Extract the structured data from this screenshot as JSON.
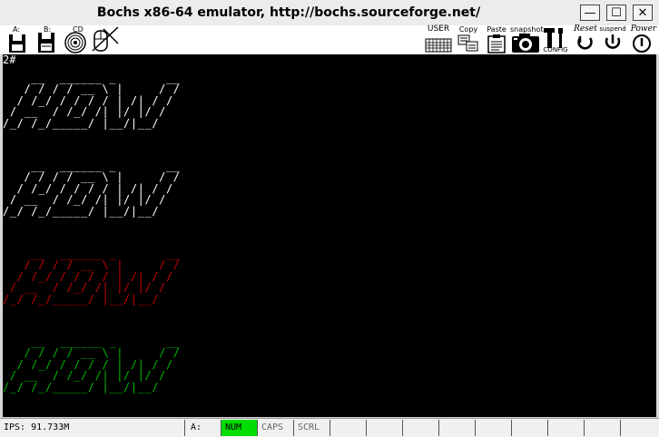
{
  "window": {
    "title": "Bochs x86-64 emulator, http://bochs.sourceforge.net/",
    "minimize_glyph": "—",
    "maximize_glyph": "☐",
    "close_glyph": "✕"
  },
  "toolbar": {
    "floppy_a": "A:",
    "floppy_b": "B:",
    "cdrom": "CD",
    "user": "USER",
    "copy": "Copy",
    "paste": "Paste",
    "snapshot": "snapshot",
    "config": "CONFIG",
    "reset": "Reset",
    "suspend": "suspend",
    "power": "Power"
  },
  "screen": {
    "prompt": "2#",
    "logo": "    __  ______ _       __\n   / / / / __ \\ |     / /\n  / /_/ / / / / | /| / / \n / __  / /_/ /| |/ |/ /  \n/_/ /_/_____/ |__/|__/   ",
    "colors": [
      "#ffffff",
      "#ffffff",
      "#cc0000",
      "#00bb00"
    ]
  },
  "status": {
    "ips": "IPS: 91.733M",
    "drive": "A:",
    "num": "NUM",
    "caps": "CAPS",
    "scrl": "SCRL",
    "active_color": "#00dd00"
  }
}
